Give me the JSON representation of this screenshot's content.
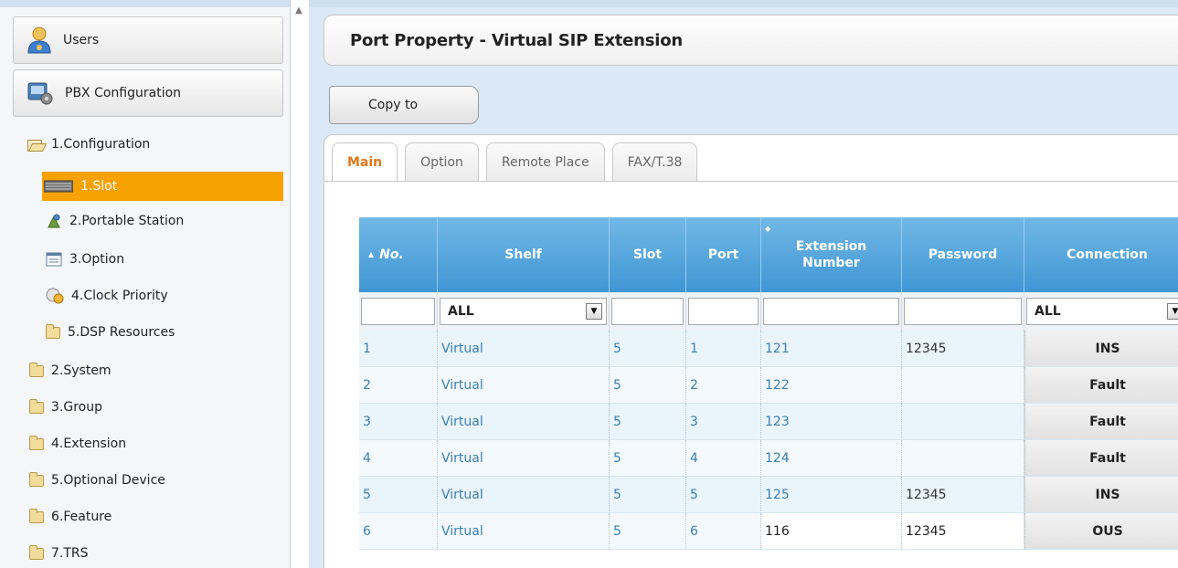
{
  "sidebar": {
    "users_label": "Users",
    "pbx_label": "PBX Configuration",
    "tree": [
      {
        "label": "1.Configuration",
        "icon": "folder-open-icon"
      },
      {
        "label": "1.Slot",
        "icon": "slot-icon",
        "selected": true
      },
      {
        "label": "2.Portable Station",
        "icon": "portable-station-icon"
      },
      {
        "label": "3.Option",
        "icon": "option-icon"
      },
      {
        "label": "4.Clock Priority",
        "icon": "clock-priority-icon"
      },
      {
        "label": "5.DSP Resources",
        "icon": "folder-icon"
      },
      {
        "label": "2.System",
        "icon": "folder-icon"
      },
      {
        "label": "3.Group",
        "icon": "folder-icon"
      },
      {
        "label": "4.Extension",
        "icon": "folder-icon"
      },
      {
        "label": "5.Optional Device",
        "icon": "folder-icon"
      },
      {
        "label": "6.Feature",
        "icon": "folder-icon"
      },
      {
        "label": "7.TRS",
        "icon": "folder-icon"
      }
    ]
  },
  "main": {
    "title": "Port Property - Virtual SIP Extension",
    "copy_button": "Copy to",
    "tabs": [
      {
        "label": "Main",
        "active": true
      },
      {
        "label": "Option"
      },
      {
        "label": "Remote Place"
      },
      {
        "label": "FAX/T.38"
      }
    ],
    "grid": {
      "headers": {
        "no": "No.",
        "shelf": "Shelf",
        "slot": "Slot",
        "port": "Port",
        "ext_line1": "Extension",
        "ext_line2": "Number",
        "password": "Password",
        "connection": "Connection"
      },
      "filters": {
        "shelf": "ALL",
        "connection": "ALL"
      },
      "rows": [
        {
          "no": "1",
          "shelf": "Virtual",
          "slot": "5",
          "port": "1",
          "ext": "121",
          "password": "12345",
          "connection": "INS"
        },
        {
          "no": "2",
          "shelf": "Virtual",
          "slot": "5",
          "port": "2",
          "ext": "122",
          "password": "",
          "connection": "Fault"
        },
        {
          "no": "3",
          "shelf": "Virtual",
          "slot": "5",
          "port": "3",
          "ext": "123",
          "password": "",
          "connection": "Fault"
        },
        {
          "no": "4",
          "shelf": "Virtual",
          "slot": "5",
          "port": "4",
          "ext": "124",
          "password": "",
          "connection": "Fault"
        },
        {
          "no": "5",
          "shelf": "Virtual",
          "slot": "5",
          "port": "5",
          "ext": "125",
          "password": "12345",
          "connection": "INS"
        },
        {
          "no": "6",
          "shelf": "Virtual",
          "slot": "5",
          "port": "6",
          "ext": "116",
          "password": "12345",
          "connection": "OUS"
        }
      ]
    }
  },
  "colors": {
    "selected": "#f7a200",
    "header_blue": "#4a9fd8",
    "active_tab": "#e2771b"
  }
}
